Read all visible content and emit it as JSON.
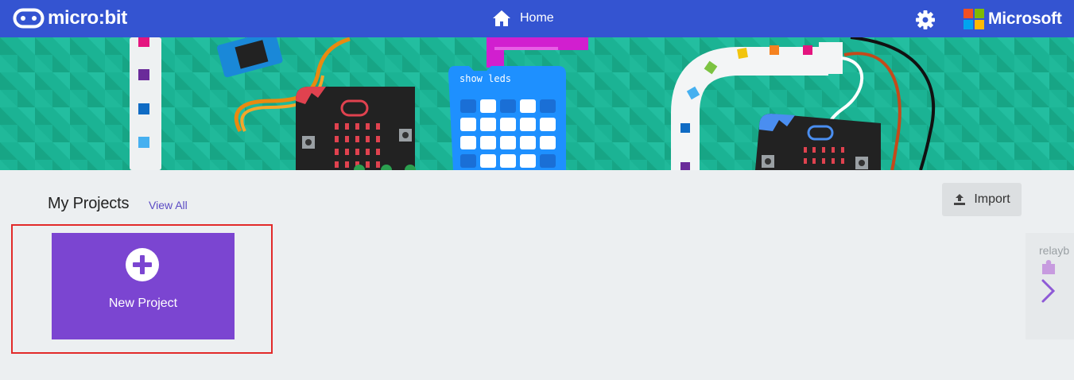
{
  "topbar": {
    "brand_label": "micro:bit",
    "home_label": "Home",
    "microsoft_label": "Microsoft",
    "background_color": "#3454d1"
  },
  "hero": {
    "code_block_label": "show leds",
    "background_color": "#1bb394"
  },
  "projects": {
    "title": "My Projects",
    "view_all_label": "View All",
    "import_label": "Import",
    "new_project_label": "New Project",
    "new_project_color": "#7b45d1",
    "recent_card_name": "relayb"
  },
  "icons": [
    "microbit-logo-icon",
    "home-icon",
    "gear-icon",
    "microsoft-logo-icon",
    "upload-icon",
    "plus-circle-icon",
    "puzzle-icon",
    "chevron-right-icon"
  ],
  "highlight_color": "#e22a2a"
}
